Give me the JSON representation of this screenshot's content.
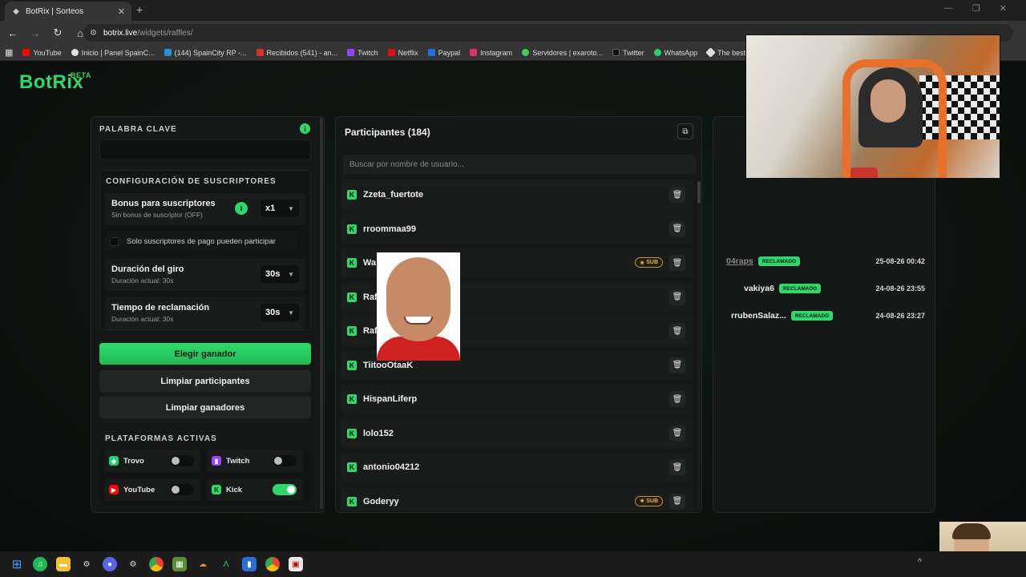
{
  "browser": {
    "tab_title": "BotRix | Sorteos",
    "tab_close": "✕",
    "new_tab": "+",
    "url_host": "botrix.live",
    "url_path": "/widgets/raffles/",
    "bookmarks": [
      {
        "label": "YouTube",
        "color": "#ff0000"
      },
      {
        "label": "Inicio | Panel SpainC...",
        "color": "#e0e0e0"
      },
      {
        "label": "(144) SpainCity RP -...",
        "color": "#2a8fd8"
      },
      {
        "label": "Recibidos (541) - an...",
        "color": "#d93025"
      },
      {
        "label": "Twitch",
        "color": "#9146ff"
      },
      {
        "label": "Netflix",
        "color": "#e50914"
      },
      {
        "label": "Paypal",
        "color": "#1a73e8"
      },
      {
        "label": "Instagram",
        "color": "#e1306c"
      },
      {
        "label": "Servidores | exaroto...",
        "color": "#3ecf5f"
      },
      {
        "label": "Twitter",
        "color": "#111111"
      },
      {
        "label": "WhatsApp",
        "color": "#25d366"
      },
      {
        "label": "The best streaming...",
        "color": "#dddddd"
      }
    ]
  },
  "app": {
    "logo": "BotRix",
    "logo_badge": "BETA",
    "accent": "#2fd86a"
  },
  "left": {
    "keyword_title": "PALABRA CLAVE",
    "keyword_value": "",
    "info_glyph": "i",
    "sub_config_title": "CONFIGURACIÓN DE SUSCRIPTORES",
    "sub_bonus_title": "Bonus para suscriptores",
    "sub_bonus_sub": "Sin bonus de suscriptor (OFF)",
    "sub_bonus_value": "x1",
    "paid_only_label": "Solo suscriptores de pago pueden participar",
    "spin_title": "Duración del giro",
    "spin_sub": "Duración actual: 30s",
    "spin_value": "30s",
    "claim_title": "Tiempo de reclamación",
    "claim_sub": "Duración actual: 30s",
    "claim_value": "30s",
    "btn_pick_winner": "Elegir ganador",
    "btn_clear_participants": "Limpiar participantes",
    "btn_clear_winners": "Limpiar ganadores",
    "platforms_title": "PLATAFORMAS ACTIVAS",
    "platforms": [
      {
        "label": "Trovo",
        "enabled": false,
        "color": "#1fd07a"
      },
      {
        "label": "Twitch",
        "enabled": false,
        "color": "#9146ff"
      },
      {
        "label": "YouTube",
        "enabled": false,
        "color": "#ff0000"
      },
      {
        "label": "Kick",
        "enabled": true,
        "color": "#2fd86a"
      }
    ]
  },
  "participants": {
    "title": "Participantes (184)",
    "search_placeholder": "Buscar por nombre de usuario...",
    "sub_badge": "SUB",
    "items": [
      {
        "name": "Zzeta_fuertote",
        "sub": false
      },
      {
        "name": "rroommaa99",
        "sub": false
      },
      {
        "name": "Wa",
        "sub": true
      },
      {
        "name": "Raf",
        "sub": false
      },
      {
        "name": "Raf",
        "sub": false
      },
      {
        "name": "TiitooOtaaK",
        "sub": false
      },
      {
        "name": "HispanLiferp",
        "sub": false
      },
      {
        "name": "lolo152",
        "sub": false
      },
      {
        "name": "antonio04212",
        "sub": false
      },
      {
        "name": "Goderyy",
        "sub": true
      }
    ]
  },
  "winners": {
    "claimed_label": "RECLAMADO",
    "items": [
      {
        "name": "04raps",
        "date": "25-08-26 00:42"
      },
      {
        "name": "vakiya6",
        "date": "24-08-26 23:55"
      },
      {
        "name": "rrubenSalaz...",
        "date": "24-08-26 23:27"
      }
    ]
  }
}
